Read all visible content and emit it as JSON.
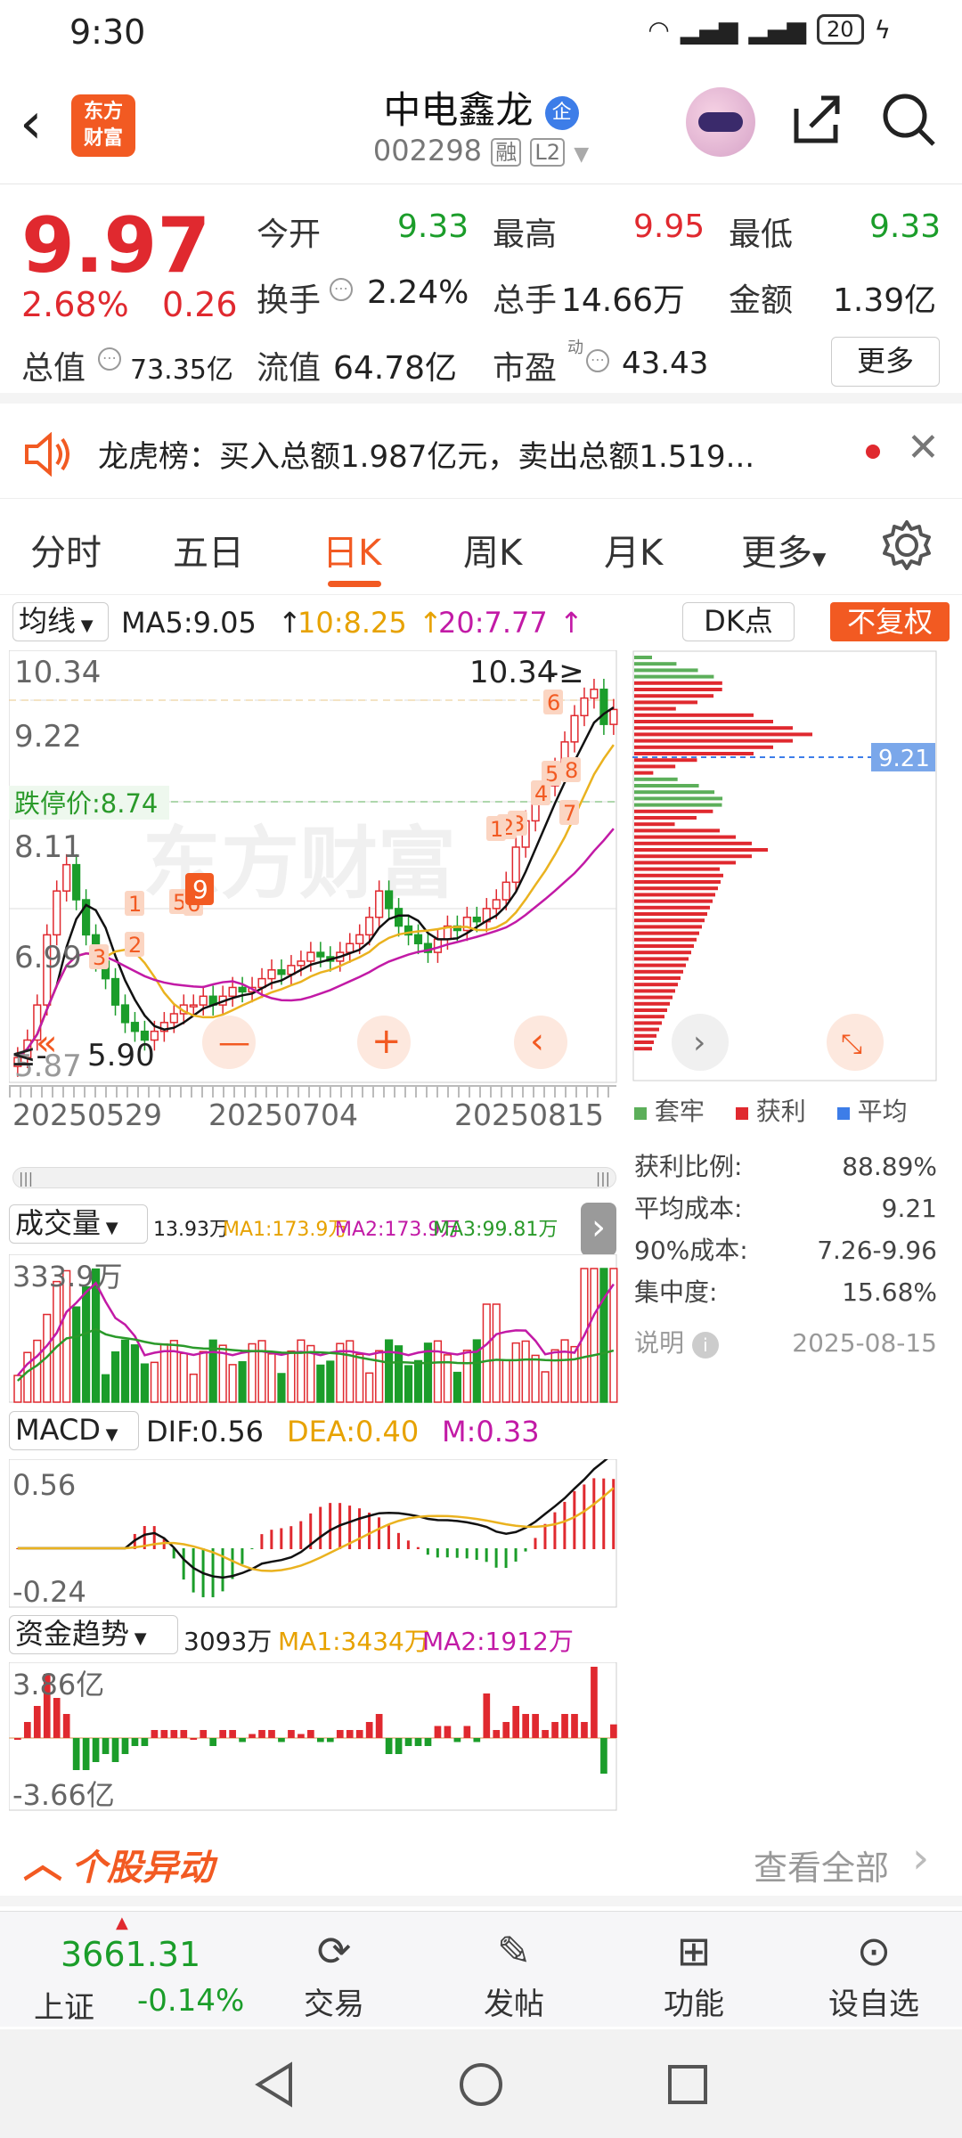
{
  "status": {
    "time": "9:30",
    "net1": "⁴ᴳ",
    "net2": "⁴ᴳ",
    "battery": "20"
  },
  "header": {
    "logo_line1": "东方",
    "logo_line2": "财富",
    "title": "中电鑫龙",
    "ent_badge": "企",
    "code": "002298",
    "tag_rong": "融",
    "tag_l2": "L2"
  },
  "quote": {
    "price": "9.97",
    "change_pct": "2.68%",
    "change_amt": "0.26",
    "open_label": "今开",
    "open": "9.33",
    "high_label": "最高",
    "high": "9.95",
    "low_label": "最低",
    "low": "9.33",
    "turnover_label": "换手",
    "turnover": "2.24%",
    "volume_label": "总手",
    "volume": "14.66万",
    "amount_label": "金额",
    "amount": "1.39亿",
    "mktcap_label": "总值",
    "mktcap": "73.35亿",
    "float_label": "流值",
    "float": "64.78亿",
    "pe_label": "市盈",
    "pe_sup": "动",
    "pe": "43.43",
    "more": "更多"
  },
  "news": {
    "text": "龙虎榜：买入总额1.987亿元，卖出总额1.519..."
  },
  "tabs": [
    "分时",
    "五日",
    "日K",
    "周K",
    "月K",
    "更多"
  ],
  "active_tab": 2,
  "ma": {
    "selector": "均线",
    "ma5": "MA5:9.05",
    "ma10": "10:8.25",
    "ma20": "20:7.77",
    "dk": "DK点",
    "fq": "不复权"
  },
  "kline": {
    "y_labels": [
      "10.34",
      "9.22",
      "8.11",
      "6.99",
      "5.87"
    ],
    "limit_down": "跌停价:8.74",
    "high_mark": "10.34",
    "low_mark": "5.90",
    "dates": [
      "20250529",
      "20250704",
      "20250815"
    ],
    "watermark": "东方财富"
  },
  "chips": {
    "price_tag": "9.21",
    "legend": [
      "套牢",
      "获利",
      "平均"
    ],
    "rows": [
      {
        "label": "获利比例:",
        "value": "88.89%"
      },
      {
        "label": "平均成本:",
        "value": "9.21"
      },
      {
        "label": "90%成本:",
        "value": "7.26-9.96"
      },
      {
        "label": "集中度:",
        "value": "15.68%"
      }
    ],
    "note": "说明",
    "date": "2025-08-15"
  },
  "volume": {
    "selector": "成交量",
    "v": "13.93万",
    "ma1": "MA1:173.9万",
    "ma2": "MA2:173.9万",
    "ma3": "MA3:99.81万",
    "top": "333.9万"
  },
  "macd": {
    "selector": "MACD",
    "dif": "DIF:0.56",
    "dea": "DEA:0.40",
    "m": "M:0.33",
    "top": "0.56",
    "bottom": "-0.24"
  },
  "fund": {
    "selector": "资金趋势",
    "v": "3093万",
    "ma1": "MA1:3434万",
    "ma2": "MA2:1912万",
    "top": "3.86亿",
    "bottom": "-3.66亿"
  },
  "movement": {
    "title": "个股异动",
    "view_all": "查看全部"
  },
  "bottom": {
    "index_value": "3661.31",
    "index_name": "上证",
    "index_change": "-0.14%",
    "items": [
      "交易",
      "发帖",
      "功能",
      "设自选"
    ]
  },
  "colors": {
    "up": "#e0292f",
    "down": "#1b9d2a",
    "accent": "#f25a22"
  }
}
